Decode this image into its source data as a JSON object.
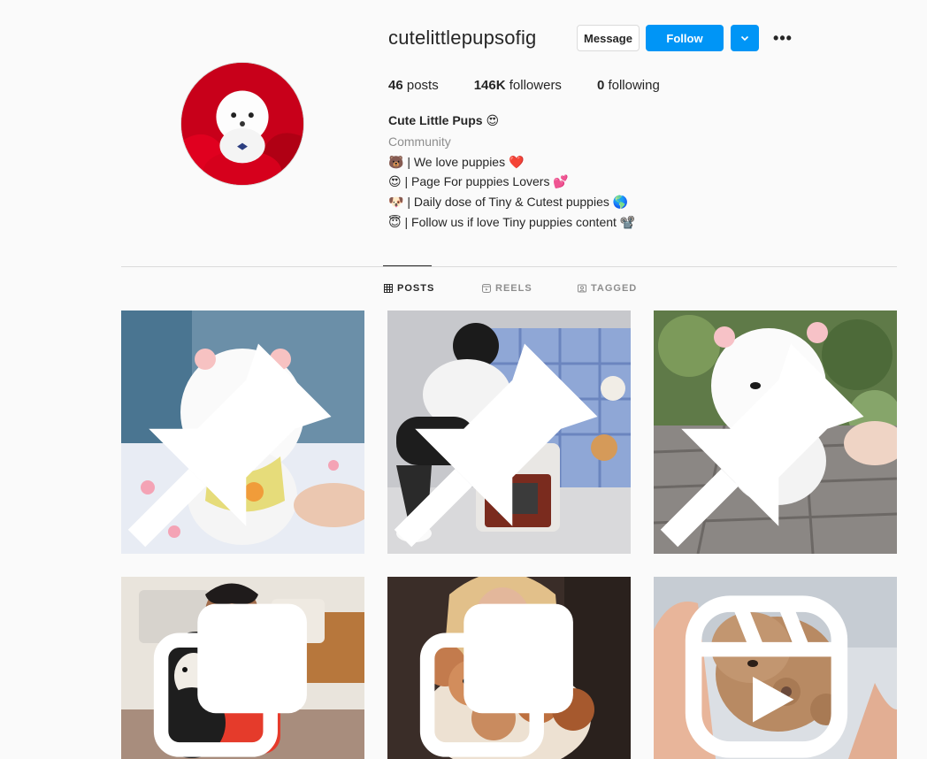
{
  "profile": {
    "username": "cutelittlepupsofig",
    "message_label": "Message",
    "follow_label": "Follow",
    "more_label": "•••",
    "stats": {
      "posts_count": "46",
      "posts_label": "posts",
      "followers_count": "146K",
      "followers_label": "followers",
      "following_count": "0",
      "following_label": "following"
    },
    "full_name": "Cute Little Pups 😍",
    "category": "Community",
    "bio": [
      "🐻 | We love puppies ❤️",
      "😍 | Page For puppies Lovers 💕",
      "🐶 | Daily dose of Tiny & Cutest puppies 🌎",
      "😇 | Follow us if love Tiny puppies content 📽️"
    ]
  },
  "tabs": [
    {
      "label": "POSTS",
      "icon": "grid-icon",
      "active": true
    },
    {
      "label": "REELS",
      "icon": "reels-icon",
      "active": false
    },
    {
      "label": "TAGGED",
      "icon": "tagged-icon",
      "active": false
    }
  ],
  "posts": [
    {
      "subject": "white pomeranian puppy",
      "badge": "pin-icon"
    },
    {
      "subject": "woman with puppy carrier",
      "badge": "pin-icon"
    },
    {
      "subject": "white pomeranian with bib",
      "badge": "pin-icon"
    },
    {
      "subject": "boy with bernedoodle puppy",
      "badge": "carousel-icon"
    },
    {
      "subject": "woman holding poodle puppies",
      "badge": "carousel-icon"
    },
    {
      "subject": "tiny puppy held in hands",
      "badge": "reels-icon"
    }
  ],
  "colors": {
    "accent": "#0095f6",
    "text": "#262626",
    "muted": "#8e8e8e",
    "border": "#dbdbdb",
    "background": "#fafafa"
  }
}
